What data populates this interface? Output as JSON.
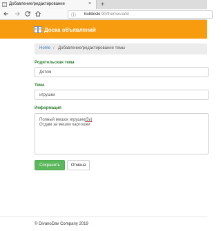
{
  "browser": {
    "tab_title": "Добавление/редактирование",
    "tab_close": "×",
    "new_tab": "+",
    "url_host": "bulldoski",
    "url_path": ":90/themes/add",
    "info_icon": "ⓘ"
  },
  "icons": {
    "back": "back-arrow-icon",
    "forward": "forward-arrow-icon",
    "reload": "reload-icon",
    "home": "home-icon",
    "brand": "board-icon"
  },
  "site": {
    "brand": "Доска объявлений",
    "accent_color": "#f69c0e"
  },
  "breadcrumb": {
    "home": "Home",
    "separator": "/",
    "current": "Добавление/редактирование темы"
  },
  "form": {
    "parent_label": "Родительская тема",
    "parent_value": "Детям",
    "topic_label": "Тема",
    "topic_value": "игрушки",
    "info_label": "Информация",
    "info_line1_prefix": "Полный мешок игрушек",
    "info_line1_suffix": "(5у)",
    "info_line2": "Отдам за мешок картошки",
    "label_color": "#2e7d32"
  },
  "buttons": {
    "save": "Сохранить",
    "cancel": "Отмена"
  },
  "footer": {
    "text": "© DivanoDav Company 2019"
  }
}
